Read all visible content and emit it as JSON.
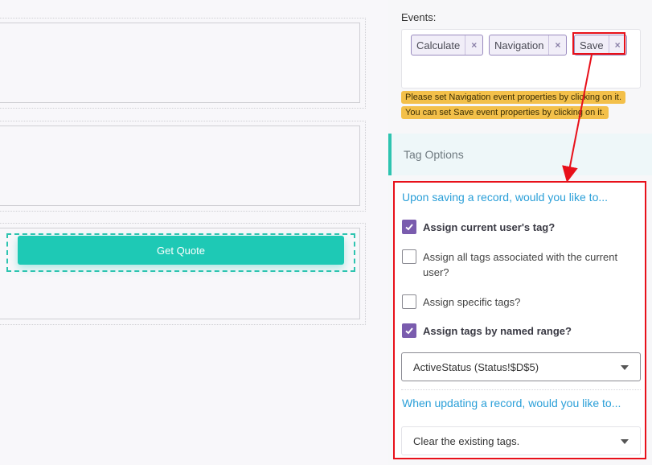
{
  "canvas": {
    "get_quote_label": "Get Quote"
  },
  "panel": {
    "events_label": "Events:",
    "events": [
      {
        "label": "Calculate",
        "remove": "×"
      },
      {
        "label": "Navigation",
        "remove": "×"
      },
      {
        "label": "Save",
        "remove": "×"
      }
    ],
    "warnings": [
      "Please set Navigation event properties by clicking on it.",
      "You can set Save event properties by clicking on it."
    ],
    "tag_options_title": "Tag Options",
    "on_save_question": "Upon saving a record, would you like to...",
    "options": [
      {
        "label": "Assign current user's tag?",
        "checked": true
      },
      {
        "label": "Assign all tags associated with the current user?",
        "checked": false
      },
      {
        "label": "Assign specific tags?",
        "checked": false
      },
      {
        "label": "Assign tags by named range?",
        "checked": true
      }
    ],
    "named_range_value": "ActiveStatus (Status!$D$5)",
    "on_update_question": "When updating a record, would you like to...",
    "update_action_value": "Clear the existing tags."
  },
  "colors": {
    "accent_teal": "#1ec9b5",
    "highlight_red": "#e8101a",
    "link_blue": "#2a9fd8",
    "checkbox_purple": "#7a5cae",
    "warning_yellow": "#f3c04a"
  }
}
